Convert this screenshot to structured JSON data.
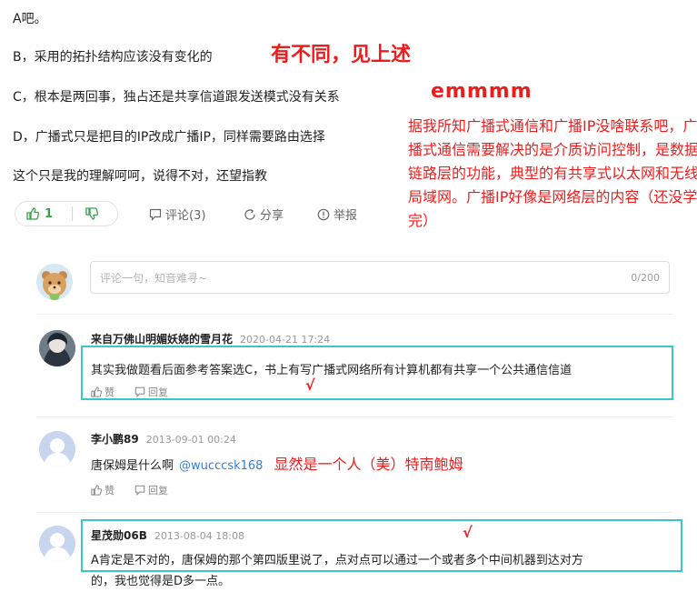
{
  "answer": {
    "line_a": "A吧。",
    "line_b": "B，采用的拓扑结构应该没有变化的",
    "note_b": "有不同，见上述",
    "line_c": "C，根本是两回事，独占还是共享信道跟发送模式没有关系",
    "note_c": "emmmm",
    "line_d": "D，广播式只是把目的IP改成广播IP，同样需要路由选择",
    "note_d": "据我所知广播式通信和广播IP没啥联系吧，广播式通信需要解决的是介质访问控制，是数据链路层的功能，典型的有共享式以太网和无线局域网。广播IP好像是网络层的内容（还没学完）",
    "closing": "这个只是我的理解呵呵，说得不对，还望指教"
  },
  "actions": {
    "like_count": "1",
    "comment": "评论(3)",
    "share": "分享",
    "report": "举报"
  },
  "comment_input": {
    "placeholder": "评论一句，知音难寻~",
    "counter": "0/200"
  },
  "comments": [
    {
      "user": "来自万佛山明媚妖娆的雪月花",
      "date": "2020-04-21 17:24",
      "text": "其实我做题看后面参考答案选C，书上有写广播式网络所有计算机都有共享一个公共通信信道",
      "mark": "√",
      "like": "赞",
      "reply": "回复"
    },
    {
      "user": "李小鹏89",
      "date": "2013-09-01 00:24",
      "text": "唐保姆是什么啊",
      "mention": "@wucccsk168",
      "note": "显然是一个人（美）特南鲍姆",
      "like": "赞",
      "reply": "回复"
    },
    {
      "user": "星茂勋06B",
      "date": "2013-08-04 18:08",
      "mark": "√",
      "text_line1": "A肯定是不对的，唐保姆的那个第四版里说了，点对点可以通过一个或者多个中间机器到达对方",
      "text_line2": "的，我也觉得是D多一点。"
    }
  ],
  "colors": {
    "annotation_red": "#ee1c1c",
    "highlight_teal": "#3ac7c5",
    "like_green": "#3b9e4a",
    "mention_blue": "#3a7bd5"
  }
}
